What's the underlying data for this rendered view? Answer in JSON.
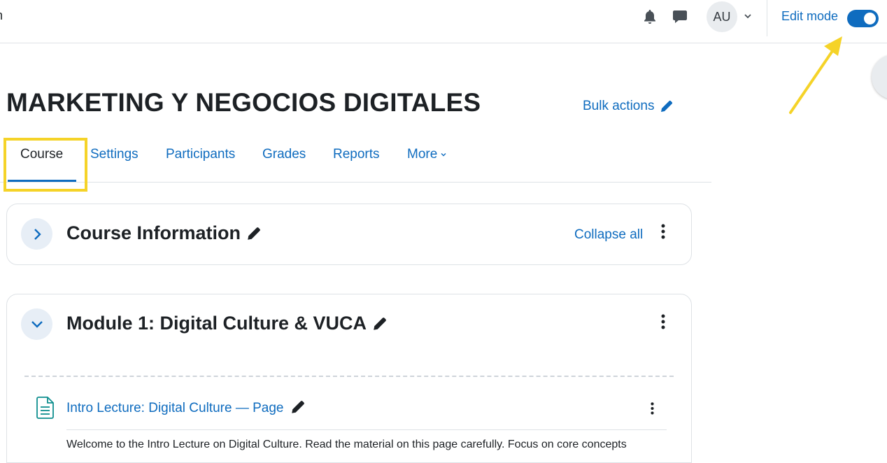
{
  "topbar": {
    "cut_text": "n",
    "avatar_initials": "AU",
    "edit_mode_label": "Edit mode",
    "edit_mode_on": true
  },
  "course": {
    "title": "MARKETING Y NEGOCIOS DIGITALES",
    "bulk_actions_label": "Bulk actions"
  },
  "tabs": [
    {
      "label": "Course",
      "active": true
    },
    {
      "label": "Settings"
    },
    {
      "label": "Participants"
    },
    {
      "label": "Grades"
    },
    {
      "label": "Reports"
    },
    {
      "label": "More"
    }
  ],
  "sections": [
    {
      "title": "Course Information",
      "collapsed": true,
      "collapse_all_label": "Collapse all"
    },
    {
      "title": "Module 1: Digital Culture & VUCA",
      "collapsed": false,
      "activity": {
        "name": "Intro Lecture: Digital Culture — Page",
        "description": "Welcome to the Intro Lecture on Digital Culture. Read the material on this page carefully. Focus on core concepts"
      }
    }
  ],
  "colors": {
    "link": "#0f6cbf",
    "annotation": "#f5d328",
    "text": "#1d2125",
    "activity_icon": "#0f8f8f"
  },
  "icons": [
    "bell-icon",
    "chat-icon",
    "chevron-down-icon",
    "pencil-icon",
    "chevron-right-icon",
    "kebab-icon",
    "page-icon"
  ]
}
